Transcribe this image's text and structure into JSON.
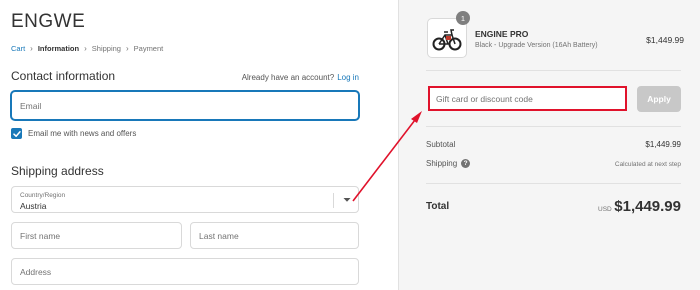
{
  "brand": "ENGWE",
  "breadcrumb": {
    "cart": "Cart",
    "information": "Information",
    "shipping": "Shipping",
    "payment": "Payment"
  },
  "contact": {
    "title": "Contact information",
    "account_prompt": "Already have an account?",
    "login_link": "Log in",
    "email_placeholder": "Email",
    "newsletter_label": "Email me with news and offers",
    "newsletter_checked": true
  },
  "shipping": {
    "title": "Shipping address",
    "country_label": "Country/Region",
    "country_value": "Austria",
    "first_name_placeholder": "First name",
    "last_name_placeholder": "Last name",
    "address_placeholder": "Address"
  },
  "order": {
    "quantity": "1",
    "product_name": "ENGINE PRO",
    "product_variant": "Black - Upgrade Version (16Ah Battery)",
    "product_price": "$1,449.99",
    "discount_placeholder": "Gift card or discount code",
    "apply_label": "Apply",
    "subtotal_label": "Subtotal",
    "subtotal_value": "$1,449.99",
    "shipping_label": "Shipping",
    "shipping_value": "Calculated at next step",
    "total_label": "Total",
    "total_currency": "USD",
    "total_value": "$1,449.99"
  },
  "colors": {
    "accent": "#1878b9",
    "annotation": "#e0122b",
    "apply_disabled": "#c8c8c8"
  },
  "icons": {
    "breadcrumb_separator": "chevron-right-icon",
    "checkbox": "checkmark-icon",
    "select": "chevron-down-icon",
    "help": "question-icon",
    "product": "bike-icon",
    "annotation": "red-arrow-icon"
  }
}
